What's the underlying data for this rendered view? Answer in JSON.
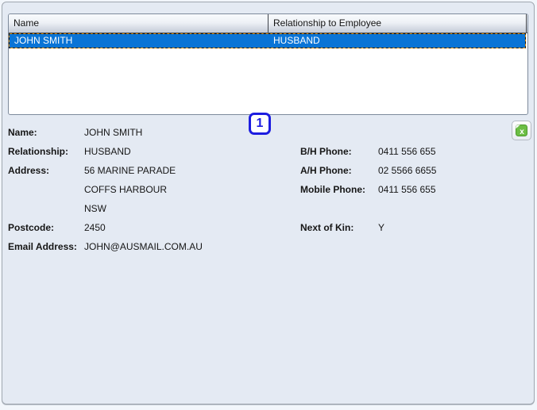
{
  "table": {
    "columns": [
      {
        "label": "Name"
      },
      {
        "label": "Relationship to Employee"
      }
    ],
    "rows": [
      {
        "name": "JOHN SMITH",
        "relationship": "HUSBAND",
        "selected": true
      }
    ]
  },
  "annotation": {
    "badge": "1"
  },
  "icons": {
    "export": "excel-export-icon"
  },
  "details": {
    "name": {
      "label": "Name:",
      "value": "JOHN SMITH"
    },
    "relationship": {
      "label": "Relationship:",
      "value": "HUSBAND"
    },
    "address": {
      "label": "Address:",
      "line1": "56 MARINE PARADE",
      "line2": "COFFS HARBOUR",
      "line3": "NSW"
    },
    "postcode": {
      "label": "Postcode:",
      "value": "2450"
    },
    "email": {
      "label": "Email Address:",
      "value": "JOHN@AUSMAIL.COM.AU"
    },
    "bh_phone": {
      "label": "B/H Phone:",
      "value": "0411 556 655"
    },
    "ah_phone": {
      "label": "A/H Phone:",
      "value": "02 5566 6655"
    },
    "mobile_phone": {
      "label": "Mobile Phone:",
      "value": "0411 556 655"
    },
    "next_of_kin": {
      "label": "Next of Kin:",
      "value": "Y"
    }
  },
  "colors": {
    "selection_blue": "#0a74d6",
    "annotation_blue": "#1d1de0",
    "excel_green": "#6cbe44",
    "panel_background": "#e4eaf3"
  }
}
